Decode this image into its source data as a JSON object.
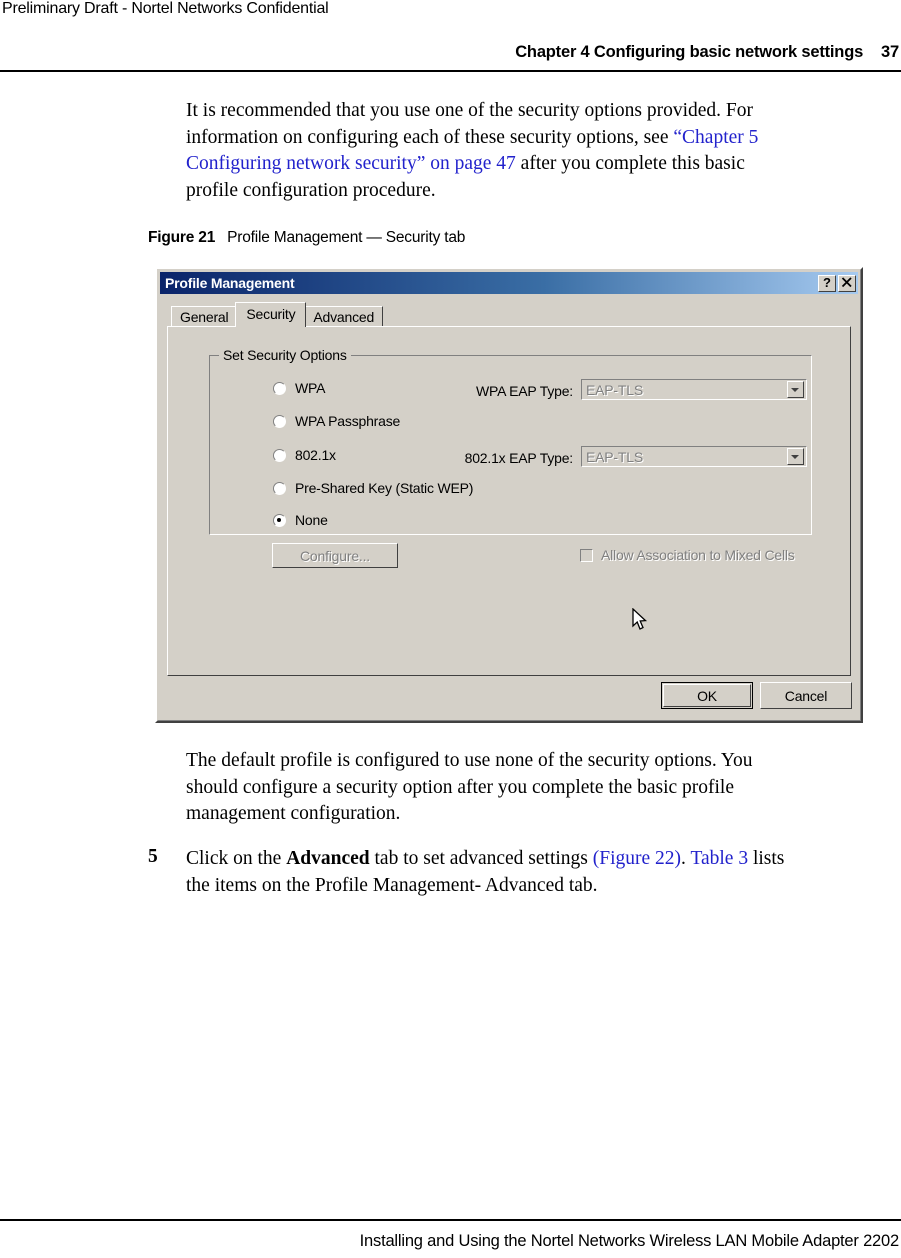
{
  "page": {
    "header_note": "Preliminary Draft - Nortel Networks Confidential",
    "header_title": "Chapter 4 Configuring basic network settings",
    "page_number": "37",
    "footer": "Installing and Using the Nortel Networks Wireless LAN Mobile Adapter 2202"
  },
  "paragraphs": {
    "intro_1": "It is recommended that you use one of the security options provided. For",
    "intro_2a": "information on configuring each of these security options, see ",
    "intro_2_link_a": "“Chapter 5",
    "intro_3_link_b": "Configuring network security” on page 47",
    "intro_3b": " after you complete this basic",
    "intro_4": "profile configuration procedure.",
    "after_1": "The default profile is configured to use none of the security options. You",
    "after_2": "should configure a security option after you complete the basic profile",
    "after_3": "management configuration.",
    "step5_number": "5",
    "step5_a": "Click on the ",
    "step5_bold": "Advanced",
    "step5_b": " tab to set advanced settings ",
    "step5_link1": "(Figure 22)",
    "step5_c": ". ",
    "step5_link2": "Table 3",
    "step5_d": " lists",
    "step5_e": "the items on the Profile Management- Advanced tab."
  },
  "figure": {
    "label": "Figure 21",
    "caption": "Profile Management — Security tab"
  },
  "dialog": {
    "title": "Profile Management",
    "help_button": "?",
    "close_button": "✕",
    "tabs": [
      {
        "label": "General",
        "active": false
      },
      {
        "label": "Security",
        "active": true
      },
      {
        "label": "Advanced",
        "active": false
      }
    ],
    "groupbox": {
      "label": "Set Security Options",
      "options": [
        {
          "label": "WPA",
          "selected": false
        },
        {
          "label": "WPA Passphrase",
          "selected": false
        },
        {
          "label": "802.1x",
          "selected": false
        },
        {
          "label": "Pre-Shared Key (Static WEP)",
          "selected": false
        },
        {
          "label": "None",
          "selected": true
        }
      ],
      "fields": [
        {
          "label": "WPA EAP Type:",
          "value": "EAP-TLS",
          "enabled": false
        },
        {
          "label": "802.1x EAP Type:",
          "value": "EAP-TLS",
          "enabled": false
        }
      ],
      "configure_button": "Configure...",
      "mixed_cells_checkbox": {
        "label": "Allow Association to Mixed Cells",
        "checked": false,
        "enabled": false
      }
    },
    "ok_button": "OK",
    "cancel_button": "Cancel"
  },
  "colors": {
    "link": "#2222cc",
    "dialog_face": "#d4d0c8",
    "titlebar_start": "#0a246a",
    "titlebar_end": "#a6caf0",
    "disabled_text": "#808080"
  }
}
